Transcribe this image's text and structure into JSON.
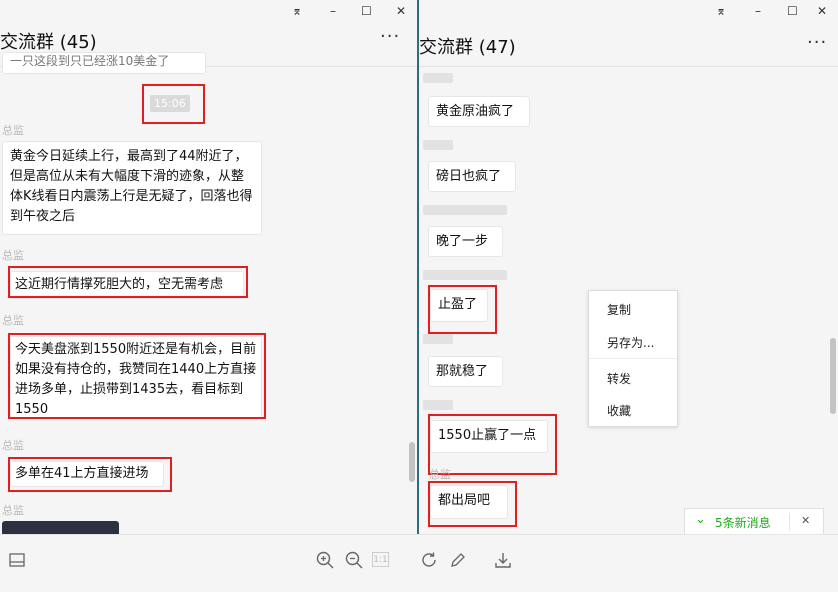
{
  "left": {
    "window_controls": {
      "pin": "⌆",
      "minimize": "–",
      "maximize": "☐",
      "close": "✕"
    },
    "title": "交流群 (45)",
    "more": "···",
    "partial_top": "一只这段到只已经涨10美金了",
    "time": "15:06",
    "messages": [
      {
        "sender": "总监",
        "text": "黄金今日延续上行，最高到了44附近了，但是高位从未有大幅度下滑的迹象，从整体K线看日内震荡上行是无疑了，回落也得到午夜之后"
      },
      {
        "sender": "总监",
        "text": "这近期行情撑死胆大的，空无需考虑"
      },
      {
        "sender": "总监",
        "text": "今天美盘涨到1550附近还是有机会，目前如果没有持仓的，我赞同在1440上方直接进场多单，止损带到1435去，看目标到1550"
      },
      {
        "sender": "总监",
        "text": "多单在41上方直接进场"
      },
      {
        "sender": "总监",
        "text": ""
      }
    ]
  },
  "right": {
    "window_controls": {
      "pin": "⌆",
      "minimize": "–",
      "maximize": "☐",
      "close": "✕"
    },
    "title": "交流群 (47)",
    "more": "···",
    "messages": [
      {
        "text": "黄金原油疯了"
      },
      {
        "text": "磅日也疯了"
      },
      {
        "text": "晚了一步"
      },
      {
        "text": "止盈了"
      },
      {
        "text": "那就稳了"
      },
      {
        "text": "1550止赢了一点"
      },
      {
        "text": "都出局吧"
      }
    ],
    "last_sender": "总监"
  },
  "context_menu": [
    "复制",
    "另存为...",
    "转发",
    "收藏"
  ],
  "toast": {
    "text": "5条新消息",
    "close": "✕",
    "color": "#1aad19"
  },
  "toolbar": {
    "zoom_badge": "1:1"
  },
  "colors": {
    "highlight": "#e02020",
    "divider": "#2d6e7e"
  }
}
